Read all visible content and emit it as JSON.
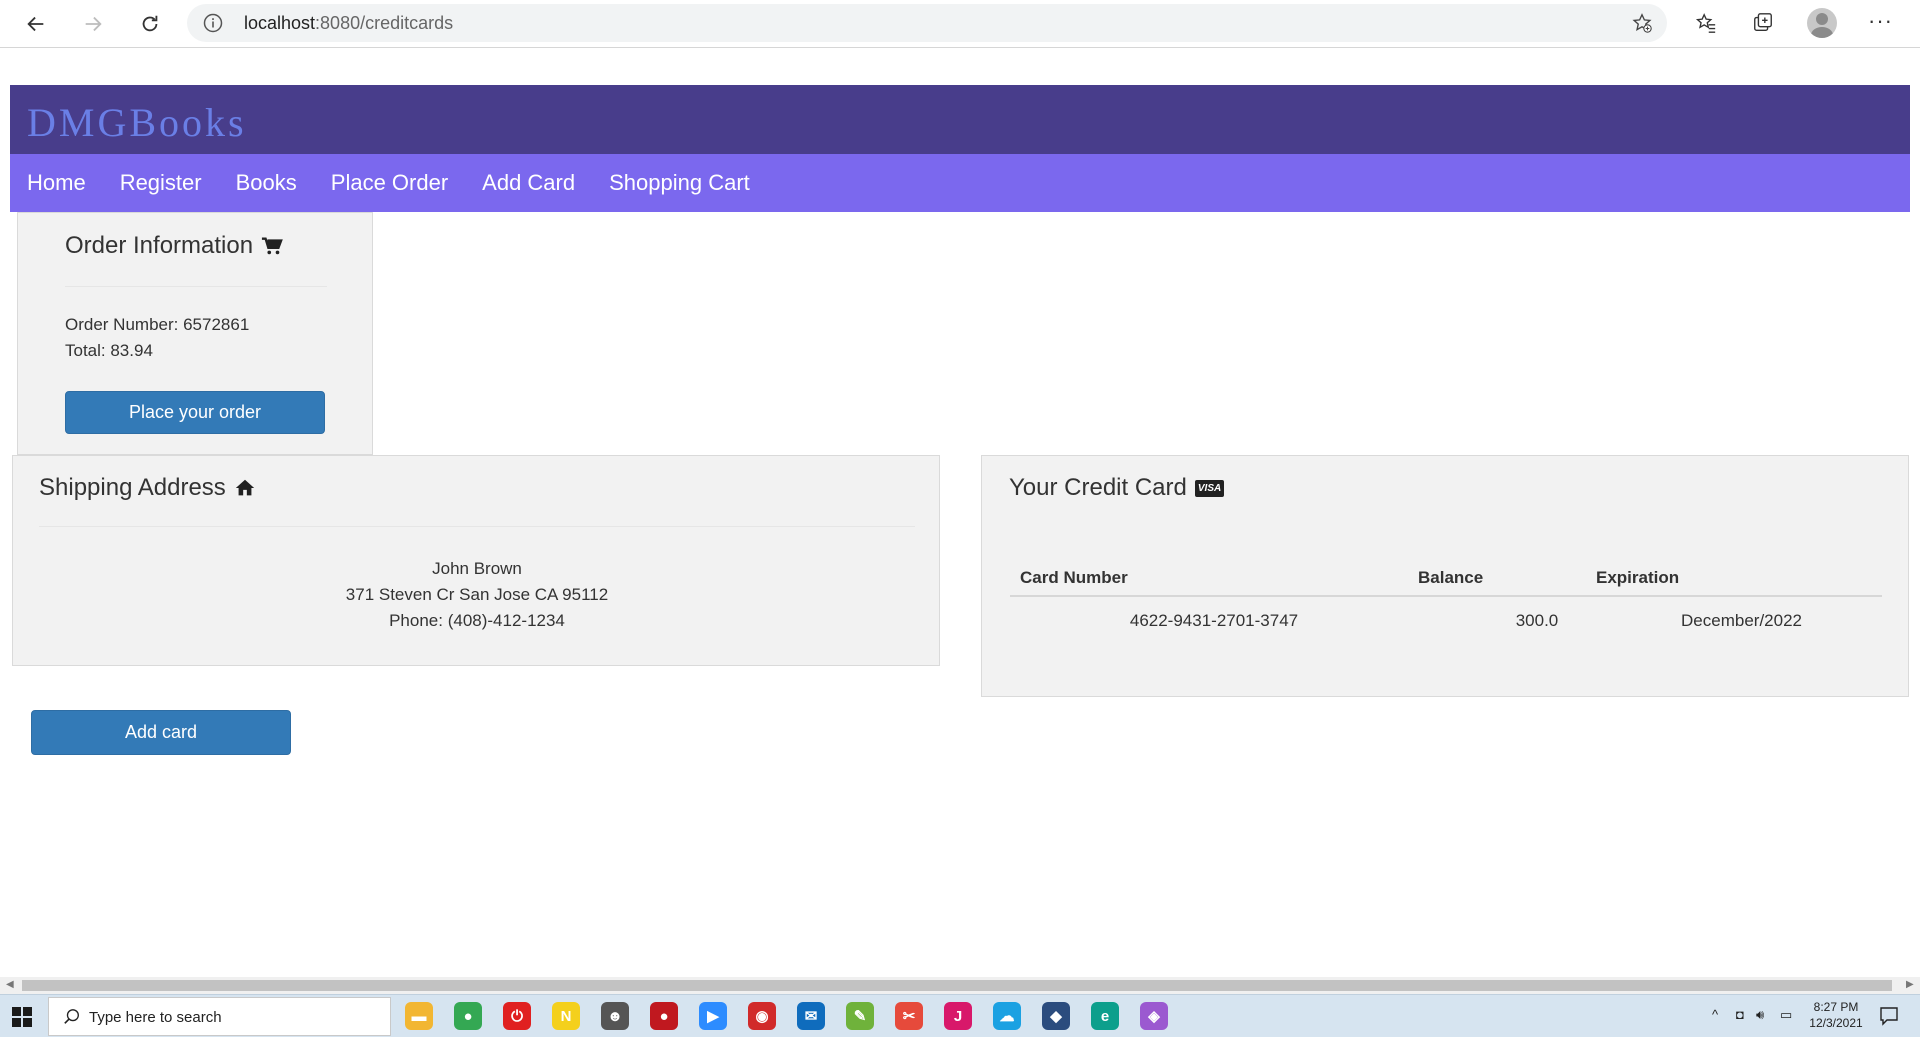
{
  "browser": {
    "url_host": "localhost",
    "url_path": ":8080/creditcards"
  },
  "site": {
    "brand": "DMGBooks",
    "nav": [
      "Home",
      "Register",
      "Books",
      "Place Order",
      "Add Card",
      "Shopping Cart"
    ]
  },
  "order": {
    "title": "Order Information",
    "number_line": "Order Number: 6572861",
    "total_line": "Total: 83.94",
    "button": "Place your order"
  },
  "shipping": {
    "title": "Shipping Address",
    "name": "John Brown",
    "address": "371 Steven Cr San Jose CA 95112",
    "phone": "Phone: (408)-412-1234"
  },
  "credit_card": {
    "title": "Your Credit Card",
    "badge": "VISA",
    "headers": [
      "Card Number",
      "Balance",
      "Expiration"
    ],
    "rows": [
      [
        "4622-9431-2701-3747",
        "300.0",
        "December/2022"
      ]
    ]
  },
  "add_card_button": "Add card",
  "taskbar": {
    "search_placeholder": "Type here to search",
    "time": "8:27 PM",
    "date": "12/3/2021",
    "icons": [
      {
        "name": "file-explorer-icon",
        "color": "#f2b632",
        "glyph": "▬"
      },
      {
        "name": "chrome-icon",
        "color": "#34a853",
        "glyph": "●"
      },
      {
        "name": "power-app-icon",
        "color": "#e02020",
        "glyph": "⏻"
      },
      {
        "name": "norton-icon",
        "color": "#f4d01c",
        "glyph": "N"
      },
      {
        "name": "avatar-app-icon",
        "color": "#555555",
        "glyph": "☻"
      },
      {
        "name": "red-app-icon",
        "color": "#c0181f",
        "glyph": "●"
      },
      {
        "name": "zoom-icon",
        "color": "#2d8cff",
        "glyph": "▶"
      },
      {
        "name": "camera-app-icon",
        "color": "#d12a2a",
        "glyph": "◉"
      },
      {
        "name": "mail-icon",
        "color": "#0f6cbd",
        "glyph": "✉"
      },
      {
        "name": "notepad-icon",
        "color": "#6fb23b",
        "glyph": "✎"
      },
      {
        "name": "snipping-tool-icon",
        "color": "#e64a3b",
        "glyph": "✂"
      },
      {
        "name": "intellij-icon",
        "color": "#d8186a",
        "glyph": "J"
      },
      {
        "name": "cloud-app-icon",
        "color": "#1ba1e2",
        "glyph": "☁"
      },
      {
        "name": "sql-studio-icon",
        "color": "#2b4c7e",
        "glyph": "◆"
      },
      {
        "name": "edge-icon",
        "color": "#0d9f8c",
        "glyph": "e"
      },
      {
        "name": "puzzle-app-icon",
        "color": "#9b59d0",
        "glyph": "◈"
      }
    ]
  }
}
